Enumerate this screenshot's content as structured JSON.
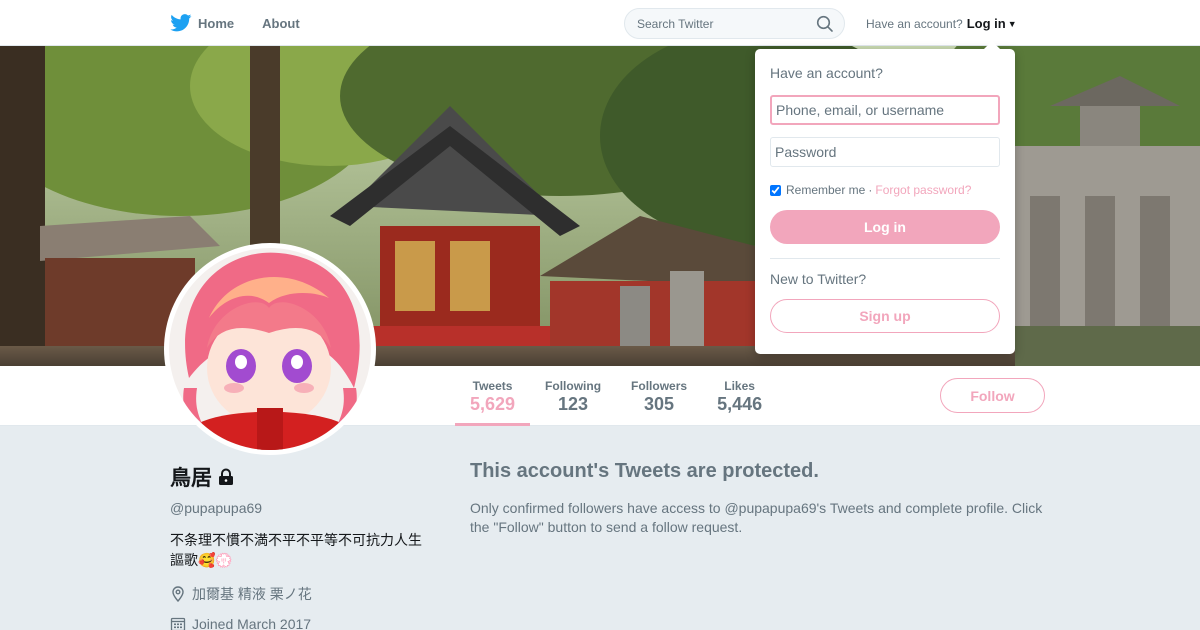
{
  "nav": {
    "home_label": "Home",
    "about_label": "About"
  },
  "search": {
    "placeholder": "Search Twitter"
  },
  "account": {
    "prompt": "Have an account?",
    "login_label": "Log in"
  },
  "dropdown": {
    "title": "Have an account?",
    "username_placeholder": "Phone, email, or username",
    "password_placeholder": "Password",
    "remember_label": "Remember me",
    "separator": "·",
    "forgot_label": "Forgot password?",
    "login_button": "Log in",
    "new_prompt": "New to Twitter?",
    "signup_button": "Sign up"
  },
  "stats": [
    {
      "label": "Tweets",
      "value": "5,629"
    },
    {
      "label": "Following",
      "value": "123"
    },
    {
      "label": "Followers",
      "value": "305"
    },
    {
      "label": "Likes",
      "value": "5,446"
    }
  ],
  "follow_button": "Follow",
  "profile": {
    "name": "鳥居",
    "handle": "@pupapupa69",
    "bio_line1": "不条理不慣不満不平不平等不可抗力人生",
    "bio_line2": "謳歌🥰💮",
    "location": "加爾基 精液 栗ノ花",
    "joined": "Joined March 2017"
  },
  "protected": {
    "heading": "This account's Tweets are protected.",
    "body": "Only confirmed followers have access to @pupapupa69's Tweets and complete profile. Click the \"Follow\" button to send a follow request."
  },
  "colors": {
    "accent": "#f2a6bc",
    "twitter_blue": "#1da1f2",
    "muted": "#66757f",
    "background": "#e6ecf0"
  },
  "icons": {
    "bird": "twitter-bird-icon",
    "search": "search-icon",
    "lock": "lock-icon",
    "location": "location-pin-icon",
    "calendar": "calendar-icon"
  }
}
